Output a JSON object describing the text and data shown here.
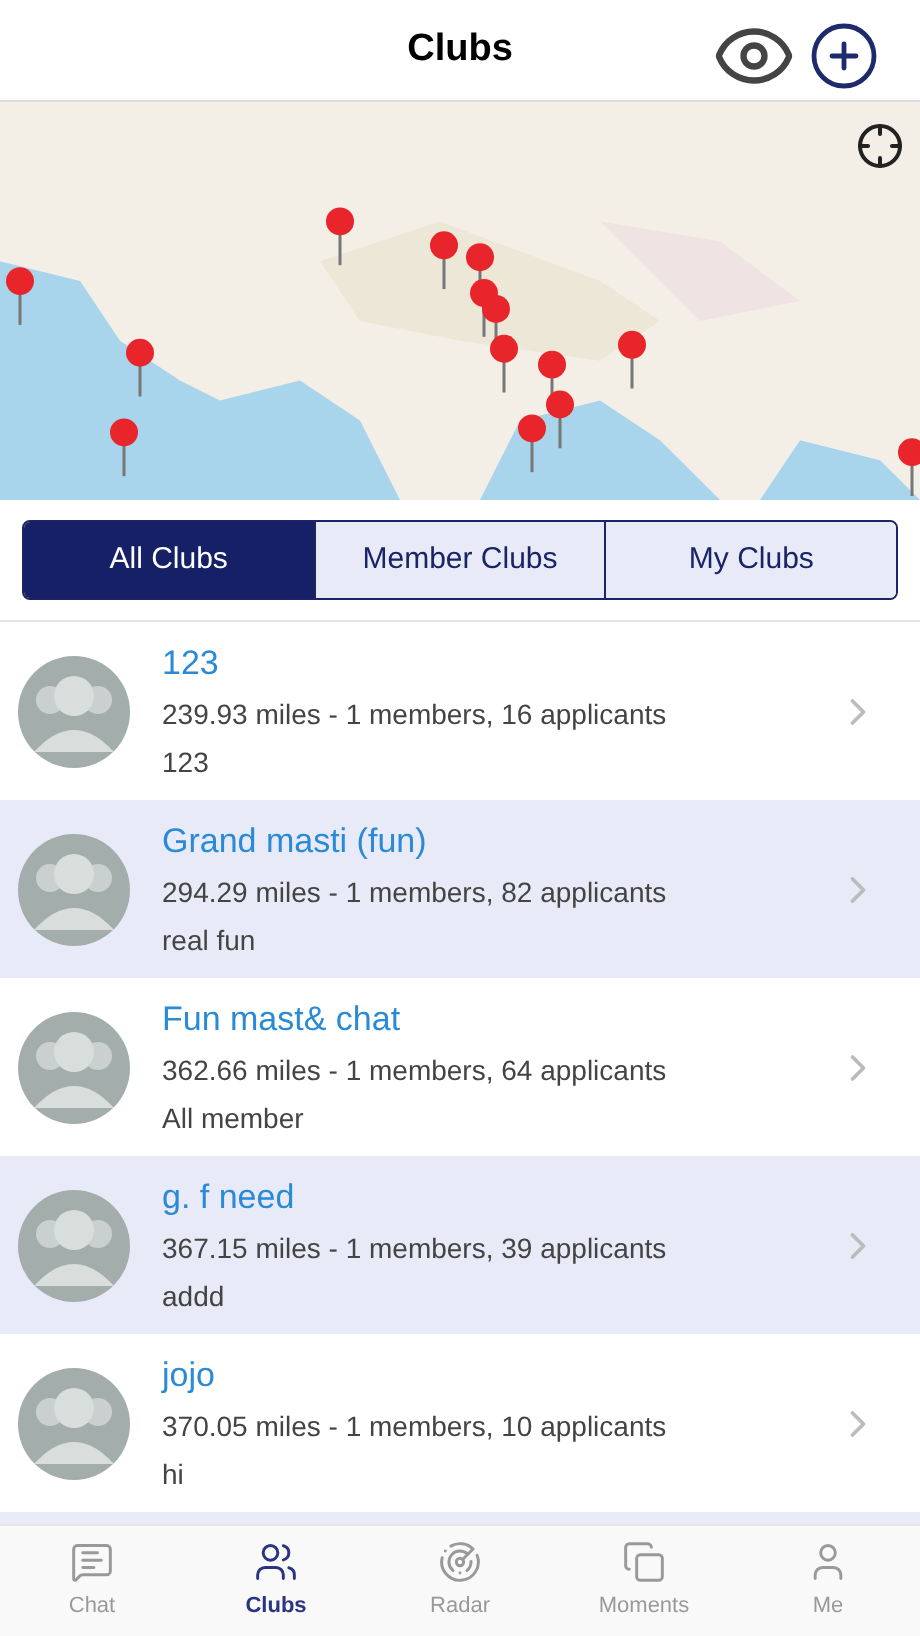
{
  "header": {
    "title": "Clubs"
  },
  "segments": [
    {
      "label": "All Clubs",
      "selected": true
    },
    {
      "label": "Member Clubs",
      "selected": false
    },
    {
      "label": "My Clubs",
      "selected": false
    }
  ],
  "clubs": [
    {
      "name": "123",
      "details": "239.93 miles - 1 members, 16 applicants",
      "description": "123"
    },
    {
      "name": "Grand masti (fun)",
      "details": "294.29 miles - 1 members, 82 applicants",
      "description": "real fun"
    },
    {
      "name": "Fun mast& chat",
      "details": "362.66 miles - 1 members, 64 applicants",
      "description": "All member"
    },
    {
      "name": "g. f need",
      "details": "367.15 miles - 1 members, 39 applicants",
      "description": "addd"
    },
    {
      "name": "jojo",
      "details": "370.05 miles - 1 members, 10 applicants",
      "description": "hi"
    }
  ],
  "tab_bar": [
    {
      "label": "Chat",
      "selected": false,
      "kind": "chat"
    },
    {
      "label": "Clubs",
      "selected": true,
      "kind": "clubs"
    },
    {
      "label": "Radar",
      "selected": false,
      "kind": "radar"
    },
    {
      "label": "Moments",
      "selected": false,
      "kind": "moments"
    },
    {
      "label": "Me",
      "selected": false,
      "kind": "me"
    }
  ]
}
